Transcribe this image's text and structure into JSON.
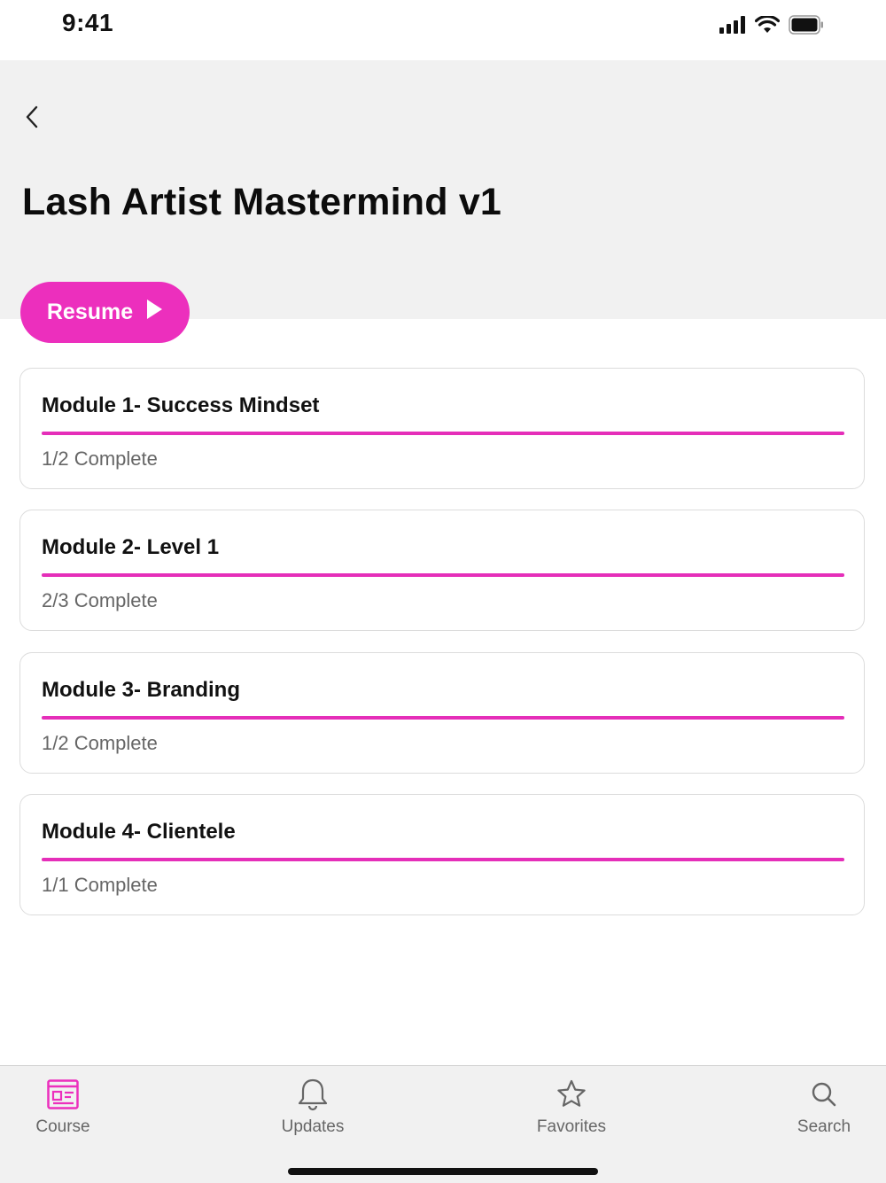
{
  "status_bar": {
    "time": "9:41"
  },
  "header": {
    "title": "Lash Artist Mastermind v1",
    "back_icon": "chevron-left-icon"
  },
  "resume_button": {
    "label": "Resume",
    "icon": "play-icon"
  },
  "colors": {
    "accent": "#ec2fbd",
    "header_bg": "#f1f1f1",
    "card_border": "#dcdcdc",
    "secondary_text": "#666666"
  },
  "modules": [
    {
      "title": "Module 1- Success Mindset",
      "status": "1/2 Complete",
      "progress": 1.0
    },
    {
      "title": "Module 2- Level 1",
      "status": "2/3 Complete",
      "progress": 1.0
    },
    {
      "title": "Module 3- Branding",
      "status": "1/2 Complete",
      "progress": 1.0
    },
    {
      "title": "Module 4- Clientele",
      "status": "1/1 Complete",
      "progress": 1.0
    }
  ],
  "tab_bar": {
    "tabs": [
      {
        "label": "Course",
        "icon": "course-icon",
        "active": true
      },
      {
        "label": "Updates",
        "icon": "bell-icon",
        "active": false
      },
      {
        "label": "Favorites",
        "icon": "star-icon",
        "active": false
      },
      {
        "label": "Search",
        "icon": "search-icon",
        "active": false
      }
    ]
  }
}
